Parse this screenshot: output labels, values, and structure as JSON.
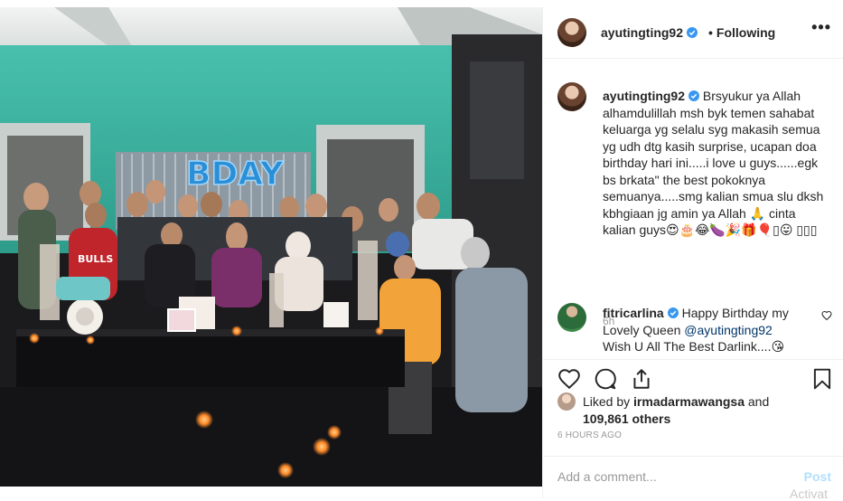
{
  "photo": {
    "balloon_text": "BDAY",
    "shirt_text": "BULLS"
  },
  "header": {
    "username": "ayutingting92",
    "follow_status": "Following",
    "more_icon": "ellipsis-icon"
  },
  "caption": {
    "username": "ayutingting92",
    "text": "Brsyukur ya Allah alhamdulillah msh byk temen sahabat keluarga yg selalu syg makasih semua yg udh dtg kasih surprise, ucapan doa birthday hari ini.....i love u guys......egk bs brkata\" the best pokoknya semuanya.....smg kalian smua slu dksh kbhgiaan jg amin ya Allah 🙏 cinta kalian guys😍🎂😂🍆🎉🎁🎈▯😛 ▯▯▯",
    "time": "6h"
  },
  "comment": {
    "username": "fitricarlina",
    "text_before": "Happy Birthday my Lovely Queen ",
    "mention": "@ayutingting92",
    "text_after": " Wish U All The Best Darlink....😘"
  },
  "likes": {
    "liked_by_prefix": "Liked by ",
    "liked_by_user": "irmadarmawangsa",
    "liked_by_and": " and",
    "others": "109,861 others"
  },
  "timestamp": "6 HOURS AGO",
  "add_comment": {
    "placeholder": "Add a comment...",
    "post_label": "Post"
  },
  "watermark": "Activat",
  "colors": {
    "verified": "#3897f0",
    "link": "#003569",
    "wall": "#3fb8a4",
    "post_disabled": "#b2dffc"
  }
}
